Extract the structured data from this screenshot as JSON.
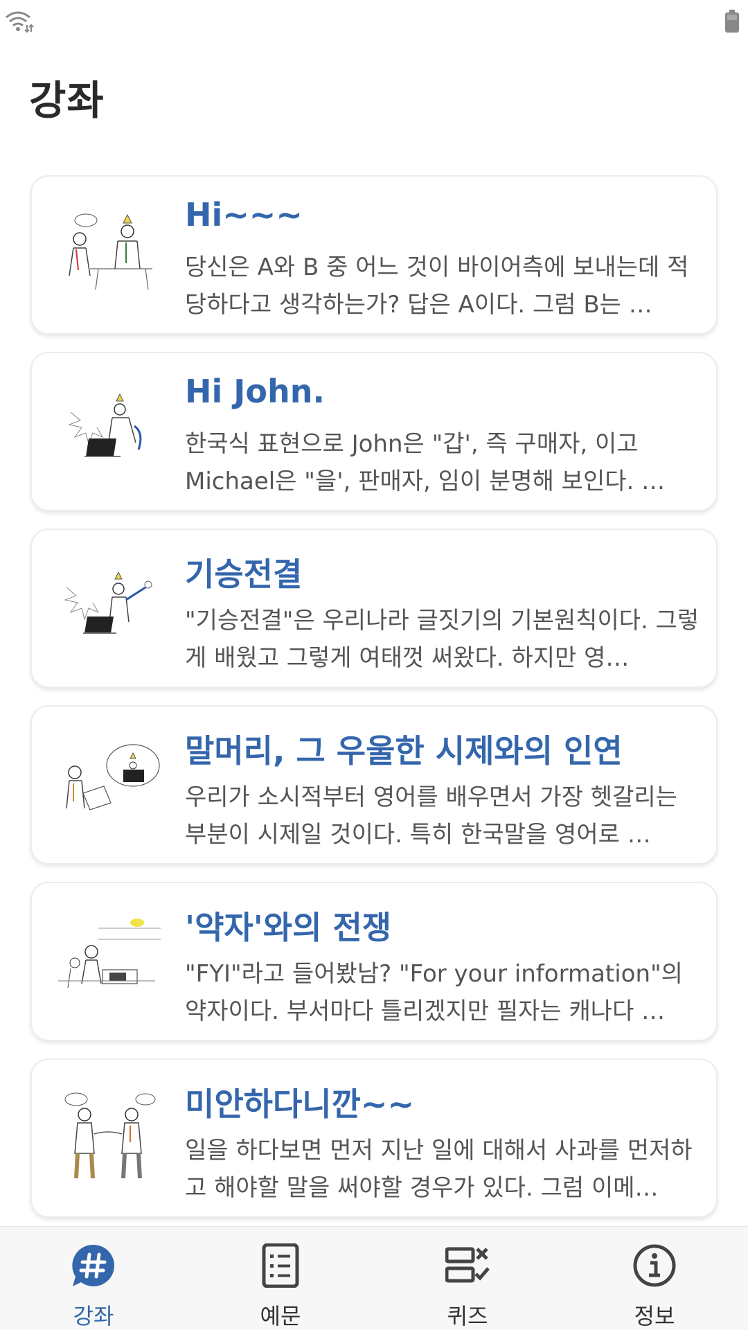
{
  "page": {
    "title": "강좌"
  },
  "colors": {
    "accent": "#3466ac",
    "title_text": "#2a2a2a",
    "body_text": "#555555"
  },
  "lectures": [
    {
      "title": "Hi~~~",
      "description": "당신은 A와 B 중 어느 것이 바이어측에 보내는데 적당하다고 생각하는가? 답은 A이다. 그럼 B는 …",
      "thumbnail": "two-people-meeting-illustration"
    },
    {
      "title": "Hi John.",
      "description": "한국식 표현으로 John은 \"갑', 즉 구매자, 이고 Michael은 \"을', 판매자, 임이 분명해 보인다. …",
      "thumbnail": "person-at-laptop-illustration"
    },
    {
      "title": "기승전결",
      "description": "\"기승전결\"은 우리나라 글짓기의 기본원칙이다. 그렇게 배웠고 그렇게 여태껏 써왔다. 하지만 영…",
      "thumbnail": "person-presenting-illustration"
    },
    {
      "title": "말머리, 그 우울한 시제와의 인연",
      "description": "우리가 소시적부터 영어를 배우면서 가장 헷갈리는 부분이 시제일 것이다. 특히 한국말을 영어로 …",
      "thumbnail": "person-thinking-illustration"
    },
    {
      "title": "'약자'와의 전쟁",
      "description": "\"FYI\"라고 들어봤남? \"For your information\"의 약자이다. 부서마다 틀리겠지만 필자는 캐나다 …",
      "thumbnail": "people-at-desk-illustration"
    },
    {
      "title": "미안하다니깐~~",
      "description": "일을 하다보면 먼저 지난 일에 대해서 사과를 먼저하고 해야할 말을 써야할 경우가 있다. 그럼 이메…",
      "thumbnail": "two-people-handshake-illustration"
    }
  ],
  "nav": [
    {
      "label": "강좌",
      "icon": "hashtag-chat-icon",
      "active": true
    },
    {
      "label": "예문",
      "icon": "document-list-icon",
      "active": false
    },
    {
      "label": "퀴즈",
      "icon": "quiz-check-icon",
      "active": false
    },
    {
      "label": "정보",
      "icon": "info-icon",
      "active": false
    }
  ]
}
